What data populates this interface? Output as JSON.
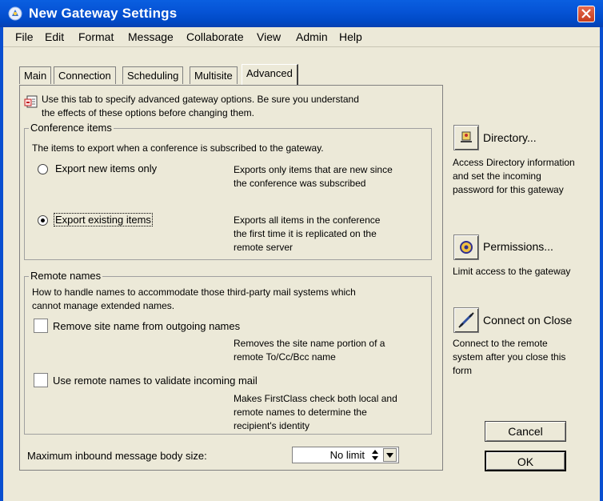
{
  "window": {
    "title": "New Gateway Settings",
    "icon": "gateway-settings-icon",
    "close_icon": "close-icon"
  },
  "menu": [
    "File",
    "Edit",
    "Format",
    "Message",
    "Collaborate",
    "View",
    "Admin",
    "Help"
  ],
  "tabs": [
    {
      "label": "Main",
      "selected": false
    },
    {
      "label": "Connection",
      "selected": false
    },
    {
      "label": "Scheduling",
      "selected": false
    },
    {
      "label": "Multisite",
      "selected": false
    },
    {
      "label": "Advanced",
      "selected": true
    }
  ],
  "intro": {
    "icon": "gateway-doc-icon",
    "line1": "Use this tab to specify advanced gateway options. Be sure you understand",
    "line2": "the effects of these options before changing them."
  },
  "conference": {
    "group_label": "Conference items",
    "description": "The items to export when a conference is subscribed to the gateway.",
    "options": [
      {
        "label": "Export new items only",
        "selected": false,
        "desc": [
          "Exports only items that are new since",
          "the conference was subscribed"
        ]
      },
      {
        "label": "Export existing items",
        "selected": true,
        "desc": [
          "Exports all items in the conference",
          "the first time it is replicated on the",
          "remote server"
        ]
      }
    ]
  },
  "remote_names": {
    "group_label": "Remote names",
    "description": [
      "How to handle names to accommodate those third-party mail systems which",
      "cannot manage extended names."
    ],
    "options": [
      {
        "label": "Remove site name from outgoing names",
        "checked": false,
        "desc": [
          "Removes the site name portion of a",
          "remote To/Cc/Bcc name"
        ]
      },
      {
        "label": "Use remote names to validate incoming mail",
        "checked": false,
        "desc": [
          "Makes FirstClass check both local and",
          "remote names to determine the",
          "recipient's identity"
        ]
      }
    ]
  },
  "max_body": {
    "label": "Maximum inbound message body size:",
    "value": "No limit"
  },
  "side": {
    "directory": {
      "label": "Directory...",
      "icon": "directory-icon",
      "desc": [
        "Access Directory information",
        "and set the incoming",
        "password for this gateway"
      ]
    },
    "permissions": {
      "label": "Permissions...",
      "icon": "permissions-icon",
      "desc": [
        "Limit access to the gateway"
      ]
    },
    "connect": {
      "label": "Connect on Close",
      "icon": "connect-icon",
      "desc": [
        "Connect to the remote",
        "system after you close this",
        "form"
      ]
    }
  },
  "buttons": {
    "cancel": "Cancel",
    "ok": "OK"
  }
}
